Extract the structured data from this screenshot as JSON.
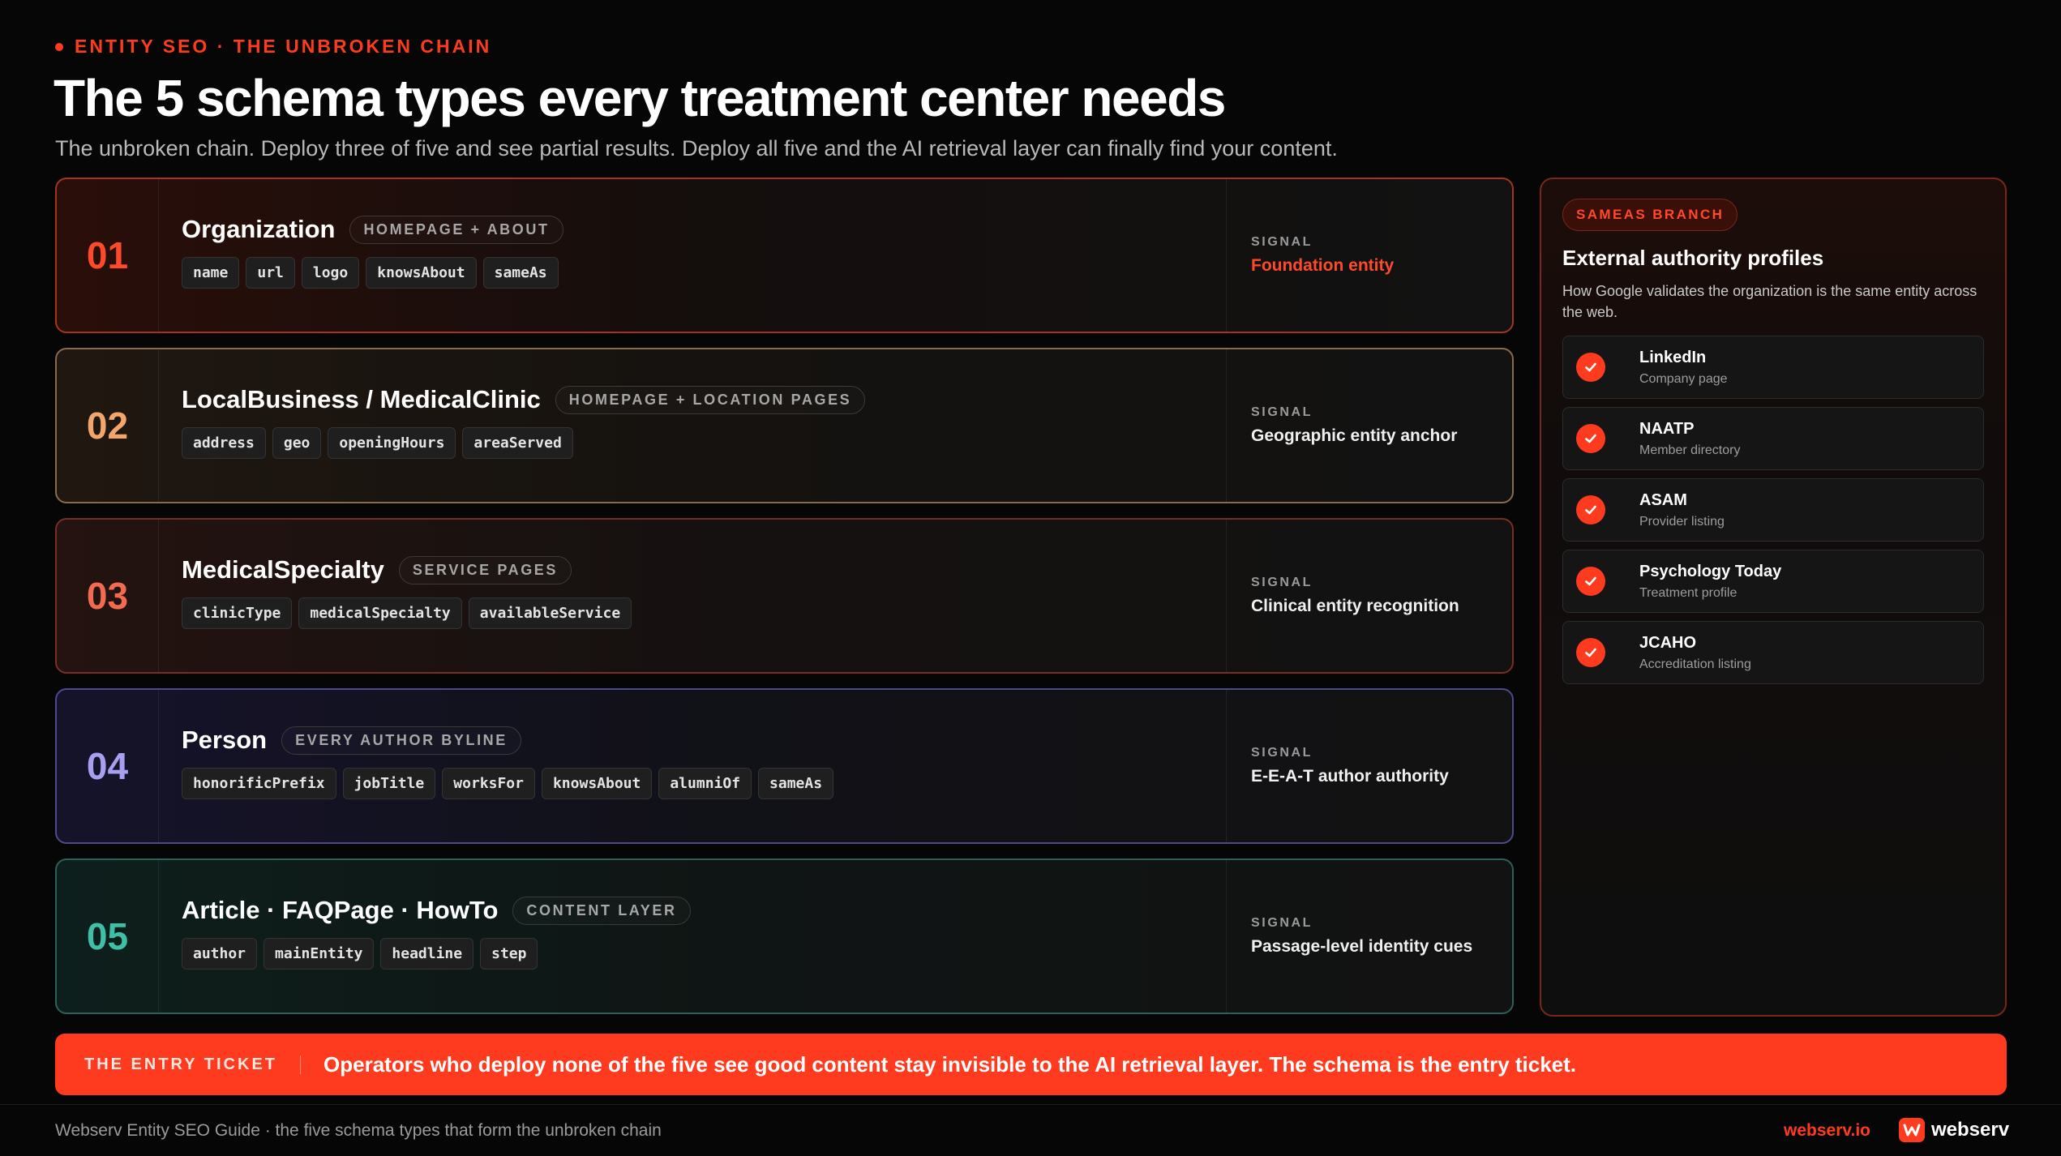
{
  "eyebrow": "ENTITY SEO · THE UNBROKEN CHAIN",
  "title": "The 5 schema types every treatment center needs",
  "subtitle": "The unbroken chain. Deploy three of five and see partial results. Deploy all five and the AI retrieval layer can finally find your content.",
  "rows": [
    {
      "num": "01",
      "name": "Organization",
      "tag": "HOMEPAGE + ABOUT",
      "props": [
        "name",
        "url",
        "logo",
        "knowsAbout",
        "sameAs"
      ],
      "signal_label": "SIGNAL",
      "signal": "Foundation entity"
    },
    {
      "num": "02",
      "name": "LocalBusiness / MedicalClinic",
      "tag": "HOMEPAGE + LOCATION PAGES",
      "props": [
        "address",
        "geo",
        "openingHours",
        "areaServed"
      ],
      "signal_label": "SIGNAL",
      "signal": "Geographic entity anchor"
    },
    {
      "num": "03",
      "name": "MedicalSpecialty",
      "tag": "SERVICE PAGES",
      "props": [
        "clinicType",
        "medicalSpecialty",
        "availableService"
      ],
      "signal_label": "SIGNAL",
      "signal": "Clinical entity recognition"
    },
    {
      "num": "04",
      "name": "Person",
      "tag": "EVERY AUTHOR BYLINE",
      "props": [
        "honorificPrefix",
        "jobTitle",
        "worksFor",
        "knowsAbout",
        "alumniOf",
        "sameAs"
      ],
      "signal_label": "SIGNAL",
      "signal": "E-E-A-T author authority"
    },
    {
      "num": "05",
      "name": "Article · FAQPage · HowTo",
      "tag": "CONTENT LAYER",
      "props": [
        "author",
        "mainEntity",
        "headline",
        "step"
      ],
      "signal_label": "SIGNAL",
      "signal": "Passage-level identity cues"
    }
  ],
  "sidebar": {
    "pill": "SAMEAS BRANCH",
    "heading": "External authority profiles",
    "description": "How Google validates the organization is the same entity across the web.",
    "items": [
      {
        "title": "LinkedIn",
        "sub": "Company page",
        "icon": "check-icon"
      },
      {
        "title": "NAATP",
        "sub": "Member directory",
        "icon": "check-icon"
      },
      {
        "title": "ASAM",
        "sub": "Provider listing",
        "icon": "check-icon"
      },
      {
        "title": "Psychology Today",
        "sub": "Treatment profile",
        "icon": "check-icon"
      },
      {
        "title": "JCAHO",
        "sub": "Accreditation listing",
        "icon": "check-icon"
      }
    ]
  },
  "ticket": {
    "label": "THE ENTRY TICKET",
    "message": "Operators who deploy none of the five see good content stay invisible to the AI retrieval layer. The schema is the entry ticket."
  },
  "footer": {
    "left": "Webserv Entity SEO Guide · the five schema types that form the unbroken chain",
    "url": "webserv.io",
    "brand": "webserv"
  },
  "colors": {
    "accent": "#ff3b1f",
    "row1": "#ff4a2a",
    "row2": "#f2a66b",
    "row3": "#f26a4f",
    "row4": "#a6a0ee",
    "row5": "#3fbfa6"
  }
}
